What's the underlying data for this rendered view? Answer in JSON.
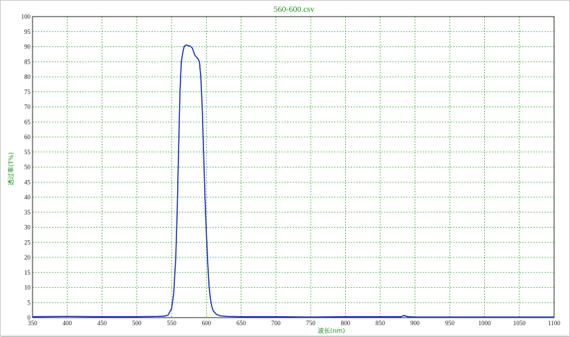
{
  "colors": {
    "grid": "#39a039",
    "frame": "#1f1f1f",
    "series": "#1530b8",
    "title": "#1f8f1f"
  },
  "chart_data": {
    "type": "line",
    "title": "560-600.csv",
    "xlabel": "波长(nm)",
    "ylabel": "透过率(T%)",
    "xlim": [
      350,
      1100
    ],
    "ylim": [
      0,
      100
    ],
    "grid": true,
    "x_ticks": [
      350,
      400,
      450,
      500,
      550,
      600,
      650,
      700,
      750,
      800,
      850,
      900,
      950,
      1000,
      1050,
      1100
    ],
    "y_ticks": [
      0,
      5,
      10,
      15,
      20,
      25,
      30,
      35,
      40,
      45,
      50,
      55,
      60,
      65,
      70,
      75,
      80,
      85,
      90,
      95,
      100
    ],
    "series": [
      {
        "name": "",
        "x": [
          350,
          400,
          450,
          500,
          530,
          540,
          545,
          550,
          553,
          556,
          558,
          560,
          562,
          564,
          566,
          568,
          570,
          572,
          574,
          576,
          578,
          580,
          582,
          584,
          586,
          588,
          590,
          592,
          594,
          596,
          598,
          600,
          602,
          604,
          606,
          608,
          610,
          615,
          620,
          630,
          650,
          700,
          750,
          800,
          850,
          880,
          884,
          890,
          900,
          950,
          1000,
          1050,
          1100
        ],
        "y": [
          0.3,
          0.4,
          0.3,
          0.3,
          0.4,
          0.5,
          0.9,
          3,
          8,
          20,
          35,
          55,
          75,
          85,
          88,
          90,
          90.5,
          90.5,
          90.4,
          90.2,
          90,
          89.5,
          88,
          87,
          86.5,
          86,
          85,
          80,
          70,
          55,
          40,
          28,
          18,
          10,
          6,
          3.5,
          2.2,
          1,
          0.6,
          0.4,
          0.3,
          0.3,
          0.2,
          0.3,
          0.3,
          0.3,
          0.7,
          0.3,
          0.2,
          0.2,
          0.2,
          0.2,
          0.2
        ]
      }
    ]
  }
}
